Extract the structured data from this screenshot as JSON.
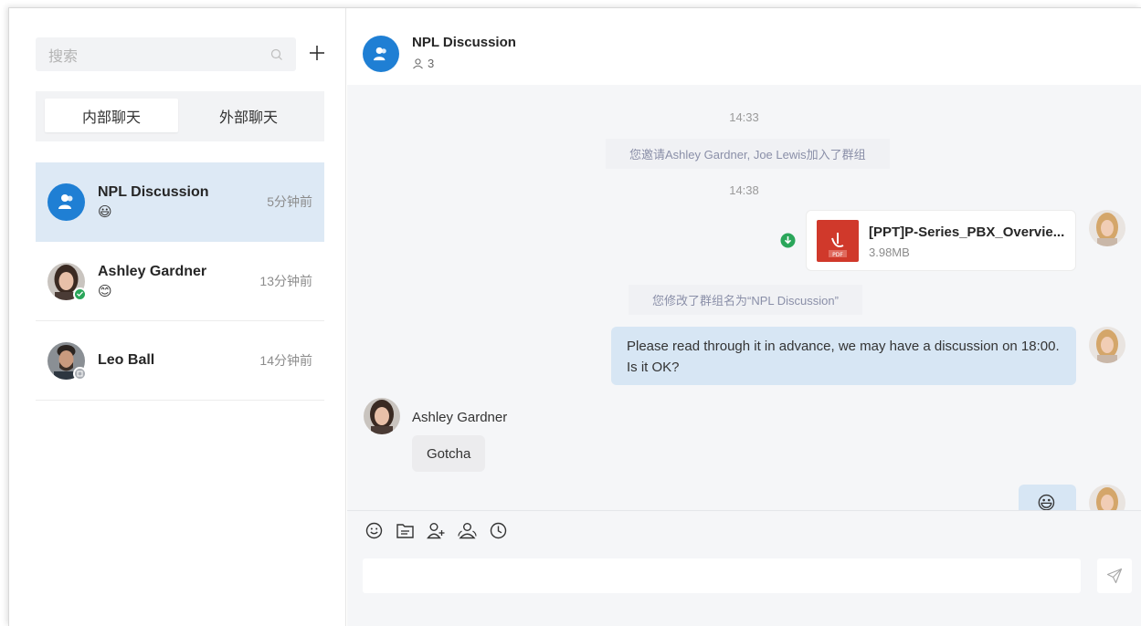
{
  "sidebar": {
    "search_placeholder": "搜索",
    "tabs": [
      {
        "label": "内部聊天",
        "active": true
      },
      {
        "label": "外部聊天",
        "active": false
      }
    ],
    "conversations": [
      {
        "name": "NPL Discussion",
        "preview": "😃",
        "time": "5分钟前",
        "selected": true,
        "type": "group"
      },
      {
        "name": "Ashley Gardner",
        "preview": "😊",
        "time": "13分钟前",
        "selected": false,
        "status": "online"
      },
      {
        "name": "Leo Ball",
        "preview": "",
        "time": "14分钟前",
        "selected": false,
        "status": "offline"
      }
    ]
  },
  "chat": {
    "title": "NPL Discussion",
    "member_count": "3",
    "messages": {
      "time1": "14:33",
      "sys1": "您邀请Ashley Gardner, Joe Lewis加入了群组",
      "time2": "14:38",
      "file_name": "[PPT]P-Series_PBX_Overvie...",
      "file_size": "3.98MB",
      "file_badge": "PDF",
      "sys2": "您修改了群组名为“NPL Discussion”",
      "my_text": "Please read through it in advance, we may have a discussion on 18:00. Is it OK?",
      "other_name": "Ashley Gardner",
      "other_text": "Gotcha",
      "last_emoji": "😃"
    },
    "toolbar_icons": [
      "emoji-icon",
      "file-icon",
      "add-member-icon",
      "members-icon",
      "history-icon"
    ]
  },
  "colors": {
    "accent": "#1f7fd4",
    "selected_row": "#dde9f5",
    "my_bubble": "#d7e6f4",
    "online": "#2aa65a",
    "pdf_red": "#d0392b"
  }
}
